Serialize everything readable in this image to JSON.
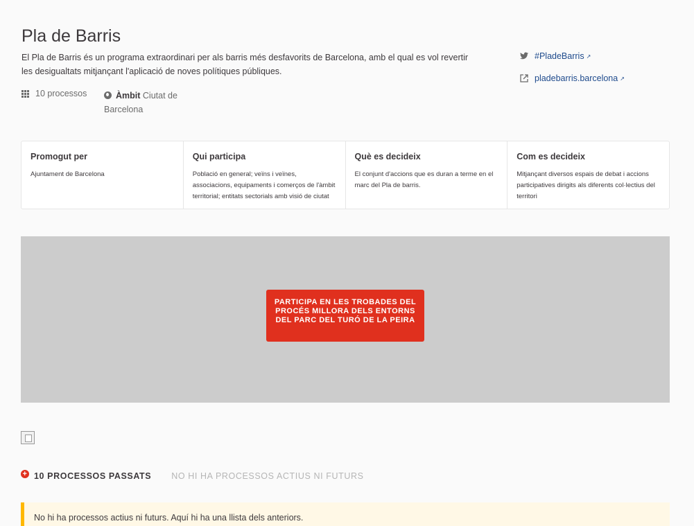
{
  "header": {
    "title": "Pla de Barris",
    "description": "El Pla de Barris és un programa extraordinari per als barris més desfavorits de Barcelona, amb el qual es vol revertir les desigualtats mitjançant l'aplicació de noves polítiques públiques."
  },
  "meta": {
    "processes_count": "10 processos",
    "scope_label": "Àmbit",
    "scope_value": "Ciutat de Barcelona"
  },
  "social": {
    "hashtag": "#PladeBarris",
    "website": "pladebarris.barcelona"
  },
  "cards": [
    {
      "title": "Promogut per",
      "text": "Ajuntament de Barcelona"
    },
    {
      "title": "Qui participa",
      "text": "Població en general; veïns i veïnes, associacions, equipaments i comerços de l'àmbit territorial; entitats sectorials amb visió de ciutat"
    },
    {
      "title": "Què es decideix",
      "text": "El conjunt d'accions que es duran a terme en el marc del Pla de barris."
    },
    {
      "title": "Com es decideix",
      "text": "Mitjançant diversos espais de debat i accions participatives dirigits als diferents col·lectius del territori"
    }
  ],
  "banner": {
    "cta_label": "PARTICIPA EN LES TROBADES DEL PROCÉS MILLORA DELS ENTORNS DEL PARC DEL TURÓ DE LA PEIRA"
  },
  "tabs": {
    "past": "10 PROCESSOS PASSATS",
    "active": "NO HI HA PROCESSOS ACTIUS NI FUTURS"
  },
  "callout": {
    "text": "No hi ha processos actius ni futurs. Aquí hi ha una llista dels anteriors."
  },
  "colors": {
    "accent": "#e0301e",
    "link": "#1e4a8c",
    "warning_border": "#ffb800",
    "banner_bg": "#cccccc"
  }
}
